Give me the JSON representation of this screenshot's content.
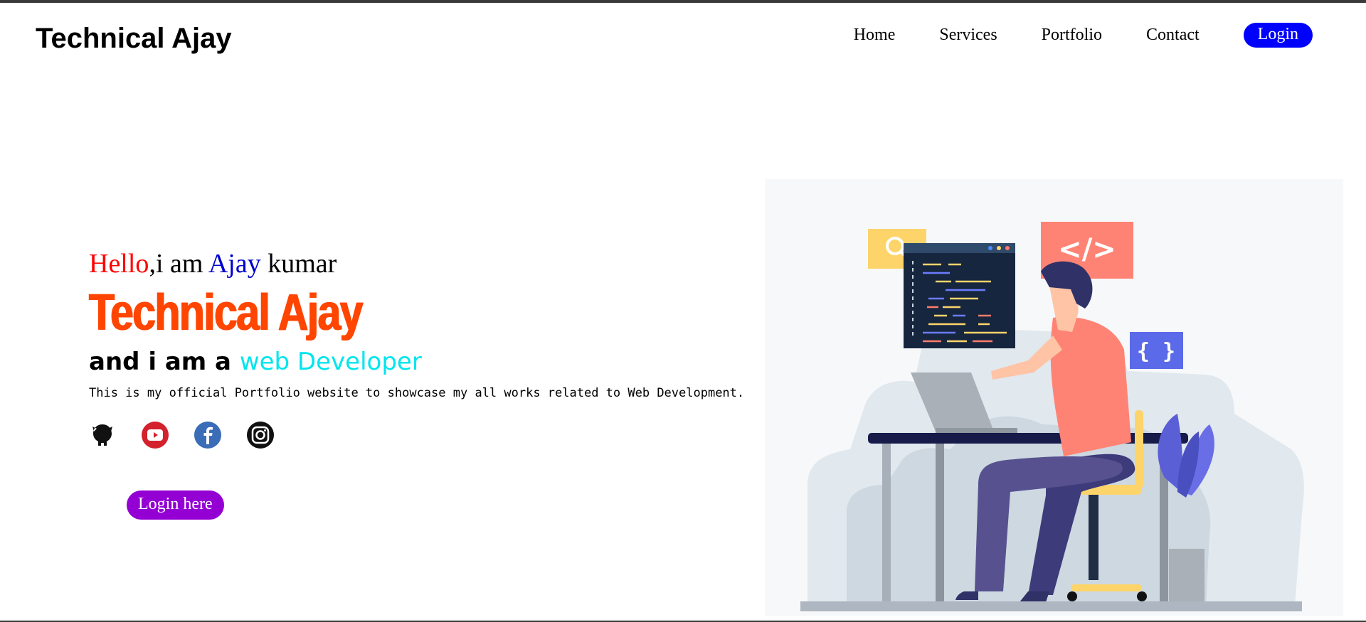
{
  "header": {
    "brand": "Technical Ajay",
    "nav": [
      "Home",
      "Services",
      "Portfolio",
      "Contact"
    ],
    "login_label": "Login"
  },
  "hero": {
    "greet_hello": "Hello",
    "greet_mid": ",i am ",
    "greet_name": "Ajay",
    "greet_last": " kumar",
    "title": "Technical Ajay",
    "role_prefix": "and i am a ",
    "role_highlight": "web Developer",
    "description": "This is my official Portfolio website to showcase my all works related to Web Development.",
    "social_icons": [
      "github-icon",
      "youtube-icon",
      "facebook-icon",
      "instagram-icon"
    ],
    "cta_label": "Login here"
  },
  "colors": {
    "nav_login_bg": "#0000ff",
    "hello": "#ff0000",
    "name": "#0000cc",
    "title": "#ff4500",
    "role_highlight": "#00e5ee",
    "cta_bg": "#9400d3"
  },
  "illustration": {
    "subject": "developer working at laptop",
    "code_badge": "</>",
    "brace_badge": "{ }"
  }
}
